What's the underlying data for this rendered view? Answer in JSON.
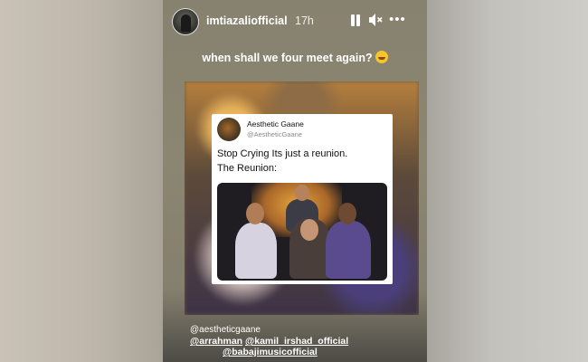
{
  "story": {
    "username": "imtiazaliofficial",
    "time": "17h",
    "caption": "when shall we four meet again?",
    "caption_emoji": "laughing-tears-emoji",
    "controls": {
      "pause": "pause-icon",
      "mute": "mute-icon",
      "more": "more-icon",
      "more_glyph": "•••"
    }
  },
  "tweet": {
    "name": "Aesthetic Gaane",
    "handle": "@AestheticGaane",
    "line1": "Stop Crying Its just a reunion.",
    "line2": "The Reunion:"
  },
  "mentions": {
    "line1": "@aestheticgaane",
    "line2a": "@arrahman",
    "line2b": "@kamil_irshad_official",
    "line3": "@babajimusicofficial"
  }
}
